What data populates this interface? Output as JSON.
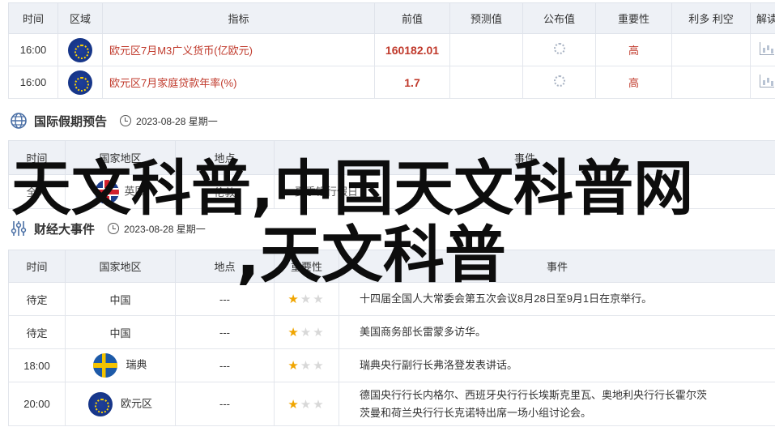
{
  "top_table": {
    "headers": [
      "时间",
      "区域",
      "指标",
      "前值",
      "预测值",
      "公布值",
      "重要性",
      "利多 利空",
      "解读"
    ],
    "rows": [
      {
        "time": "16:00",
        "region_flag": "eu-flag-icon",
        "indicator": "欧元区7月M3广义货币(亿欧元)",
        "prev": "160182.01",
        "importance": "高"
      },
      {
        "time": "16:00",
        "region_flag": "eu-flag-icon",
        "indicator": "欧元区7月家庭贷款年率(%)",
        "prev": "1.7",
        "importance": "高"
      }
    ]
  },
  "holiday_section": {
    "title": "国际假期预告",
    "date": "2023-08-28 星期一",
    "headers": [
      "时间",
      "国家地区",
      "地点",
      "事件"
    ],
    "rows": [
      {
        "time": "全天",
        "region": "英国",
        "place": "伦敦",
        "event": "夏季银行假日"
      }
    ]
  },
  "finance_section": {
    "title": "财经大事件",
    "date": "2023-08-28 星期一",
    "headers": [
      "时间",
      "国家地区",
      "地点",
      "重要性",
      "事件"
    ],
    "rows": [
      {
        "time": "待定",
        "region": "中国",
        "place": "---",
        "event": "十四届全国人大常委会第五次会议8月28日至9月1日在京举行。"
      },
      {
        "time": "待定",
        "region": "中国",
        "place": "---",
        "event": "美国商务部长雷蒙多访华。"
      },
      {
        "time": "18:00",
        "region": "瑞典",
        "place": "---",
        "event": "瑞典央行副行长弗洛登发表讲话。"
      },
      {
        "time": "20:00",
        "region": "欧元区",
        "place": "---",
        "event_line1": "德国央行行长内格尔、西班牙央行行长埃斯克里瓦、奥地利央行行长霍尔茨",
        "event_line2": "茨曼和荷兰央行行长克诺特出席一场小组讨论会。"
      }
    ]
  },
  "overlay": {
    "line1": "天文科普,中国天文科普网",
    "line2": ",天文科普"
  },
  "colors": {
    "accent_red": "#c0392b",
    "header_bg": "#eef1f6",
    "star": "#f0a500"
  }
}
